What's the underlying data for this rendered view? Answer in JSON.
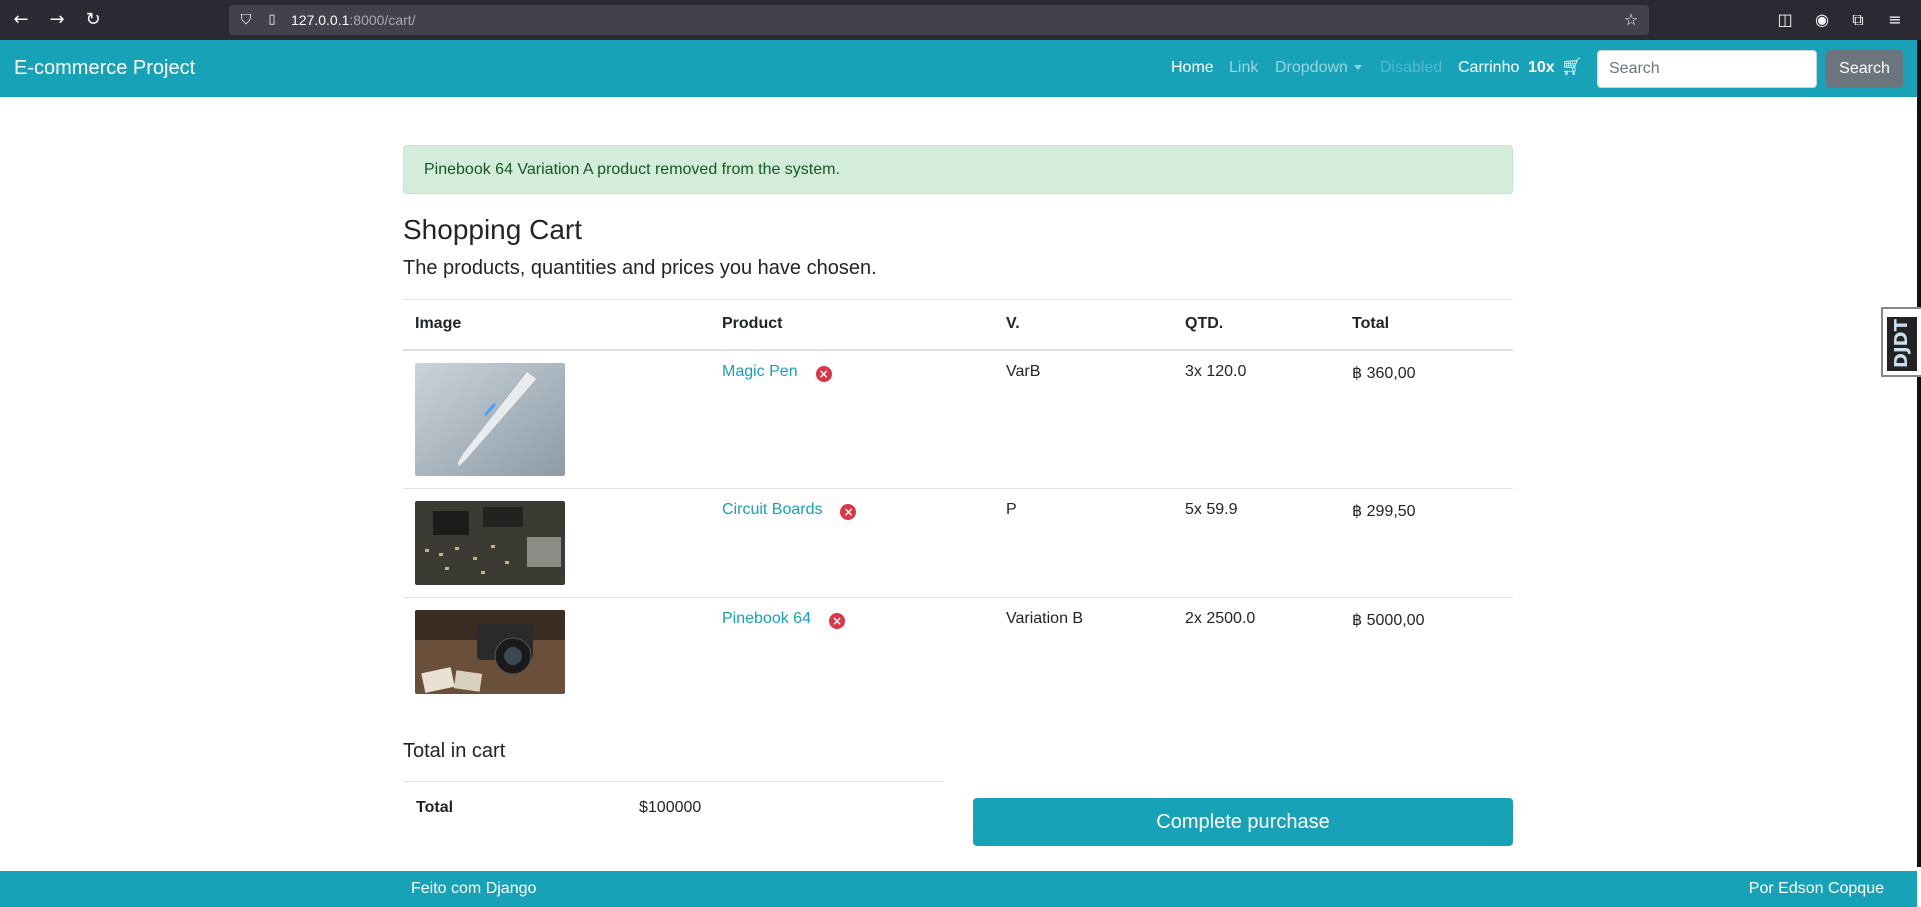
{
  "browser": {
    "url_host": "127.0.0.1",
    "url_rest": ":8000/cart/",
    "icons": [
      "back-icon",
      "forward-icon",
      "reload-icon",
      "shield-icon",
      "page-icon",
      "star-icon",
      "pocket-icon",
      "account-icon",
      "extensions-icon",
      "menu-icon"
    ]
  },
  "navbar": {
    "brand": "E-commerce Project",
    "links": {
      "home": "Home",
      "link": "Link",
      "dropdown": "Dropdown",
      "disabled": "Disabled"
    },
    "cart_label": "Carrinho",
    "cart_count": "10x",
    "search_placeholder": "Search",
    "search_button": "Search",
    "accent": "#17a2b8"
  },
  "djdt_label": "DJDT",
  "alert": {
    "message": "Pinebook 64 Variation A product removed from the system."
  },
  "cart": {
    "title": "Shopping Cart",
    "subtitle": "The products, quantities and prices you have chosen.",
    "headers": [
      "Image",
      "Product",
      "V.",
      "QTD.",
      "Total"
    ],
    "rows": [
      {
        "product": "Magic Pen",
        "variation": "VarB",
        "qty": "3x 120.0",
        "total": "฿ 360,00",
        "image": "pen-image"
      },
      {
        "product": "Circuit Boards",
        "variation": "P",
        "qty": "5x 59.9",
        "total": "฿ 299,50",
        "image": "circuit-image"
      },
      {
        "product": "Pinebook 64",
        "variation": "Variation B",
        "qty": "2x 2500.0",
        "total": "฿ 5000,00",
        "image": "camera-image"
      }
    ]
  },
  "summary": {
    "title": "Total in cart",
    "label": "Total",
    "value": "$100000",
    "button": "Complete purchase"
  },
  "footer": {
    "left": "Feito com Django",
    "right": "Por Edson Copque"
  }
}
